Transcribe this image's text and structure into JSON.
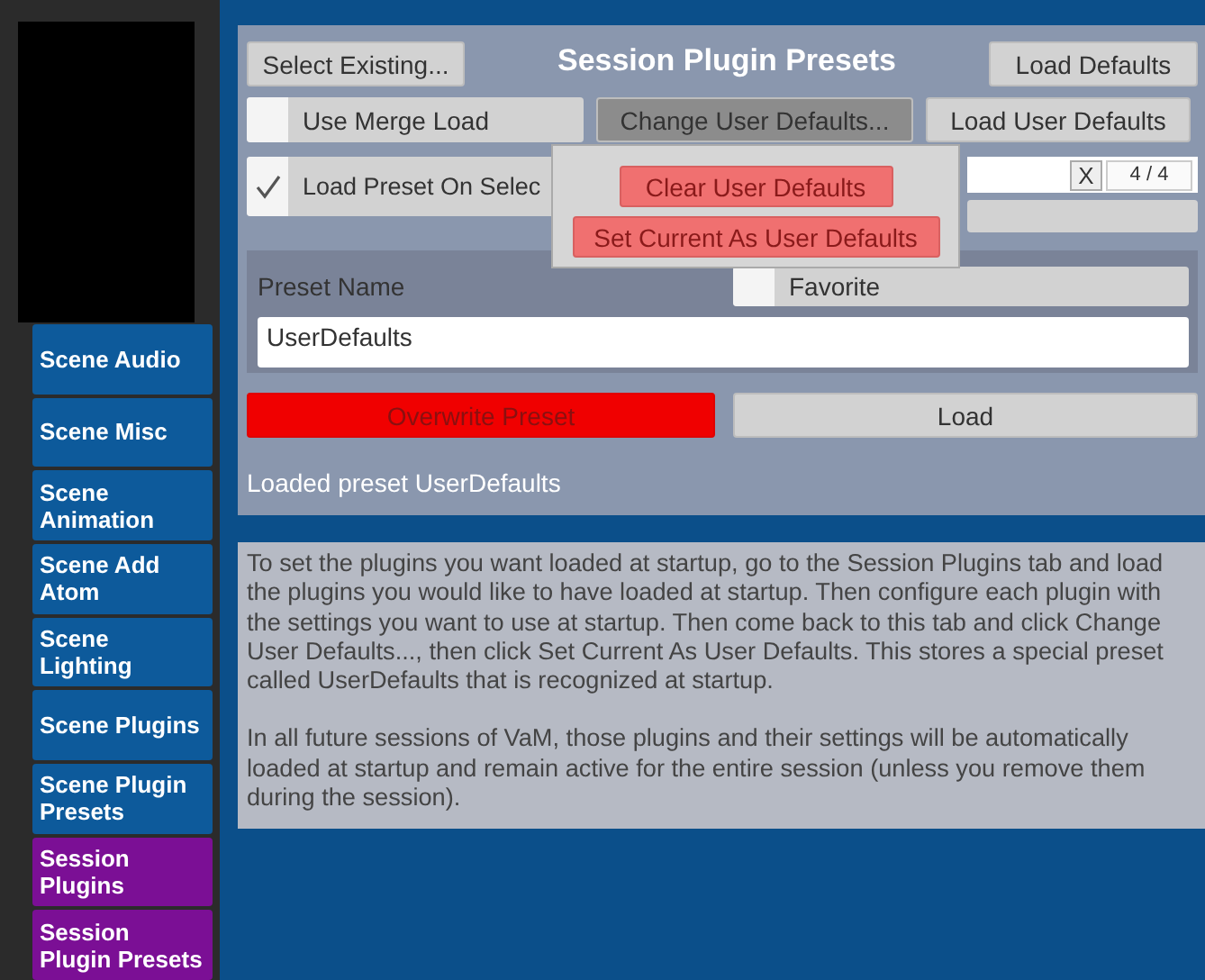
{
  "sidebar": {
    "items": [
      {
        "label": "Scene Audio",
        "color": "#0d5a9b"
      },
      {
        "label": "Scene Misc",
        "color": "#0d5a9b"
      },
      {
        "label": "Scene Animation",
        "color": "#0d5a9b"
      },
      {
        "label": "Scene Add Atom",
        "color": "#0d5a9b"
      },
      {
        "label": "Scene Lighting",
        "color": "#0d5a9b"
      },
      {
        "label": "Scene Plugins",
        "color": "#0d5a9b"
      },
      {
        "label": "Scene Plugin Presets",
        "color": "#0d5a9b"
      },
      {
        "label": "Session Plugins",
        "color": "#7b0f95"
      },
      {
        "label": "Session Plugin Presets",
        "color": "#7b0f95"
      }
    ]
  },
  "panel": {
    "title": "Session Plugin Presets",
    "select_existing": "Select Existing...",
    "load_defaults": "Load Defaults",
    "use_merge_load": {
      "label": "Use Merge Load",
      "checked": false
    },
    "change_user_defaults": {
      "label": "Change User Defaults...",
      "pressed": true
    },
    "load_user_defaults": "Load User Defaults",
    "load_preset_on_select": {
      "label": "Load Preset On Selec",
      "checked": true
    },
    "search": {
      "clear": "X",
      "count": "4 / 4"
    },
    "preset_name": {
      "label": "Preset Name",
      "value": "UserDefaults"
    },
    "favorite": {
      "label": "Favorite",
      "checked": false
    },
    "overwrite": "Overwrite Preset",
    "load": "Load",
    "status": "Loaded preset UserDefaults"
  },
  "popup": {
    "items": [
      "Clear User Defaults",
      "Set Current As User Defaults"
    ]
  },
  "description": [
    "To set the plugins you want loaded at startup, go to the Session Plugins tab and load the plugins you would like to have loaded at startup. Then configure each plugin with the settings you want to use at startup. Then come back to this tab and click Change User Defaults..., then click Set Current As User Defaults. This stores a special preset called UserDefaults that is recognized at startup.",
    "In all future sessions of VaM, those plugins and their settings will be automatically loaded at startup and remain active for the entire session (unless you remove them during the session)."
  ]
}
